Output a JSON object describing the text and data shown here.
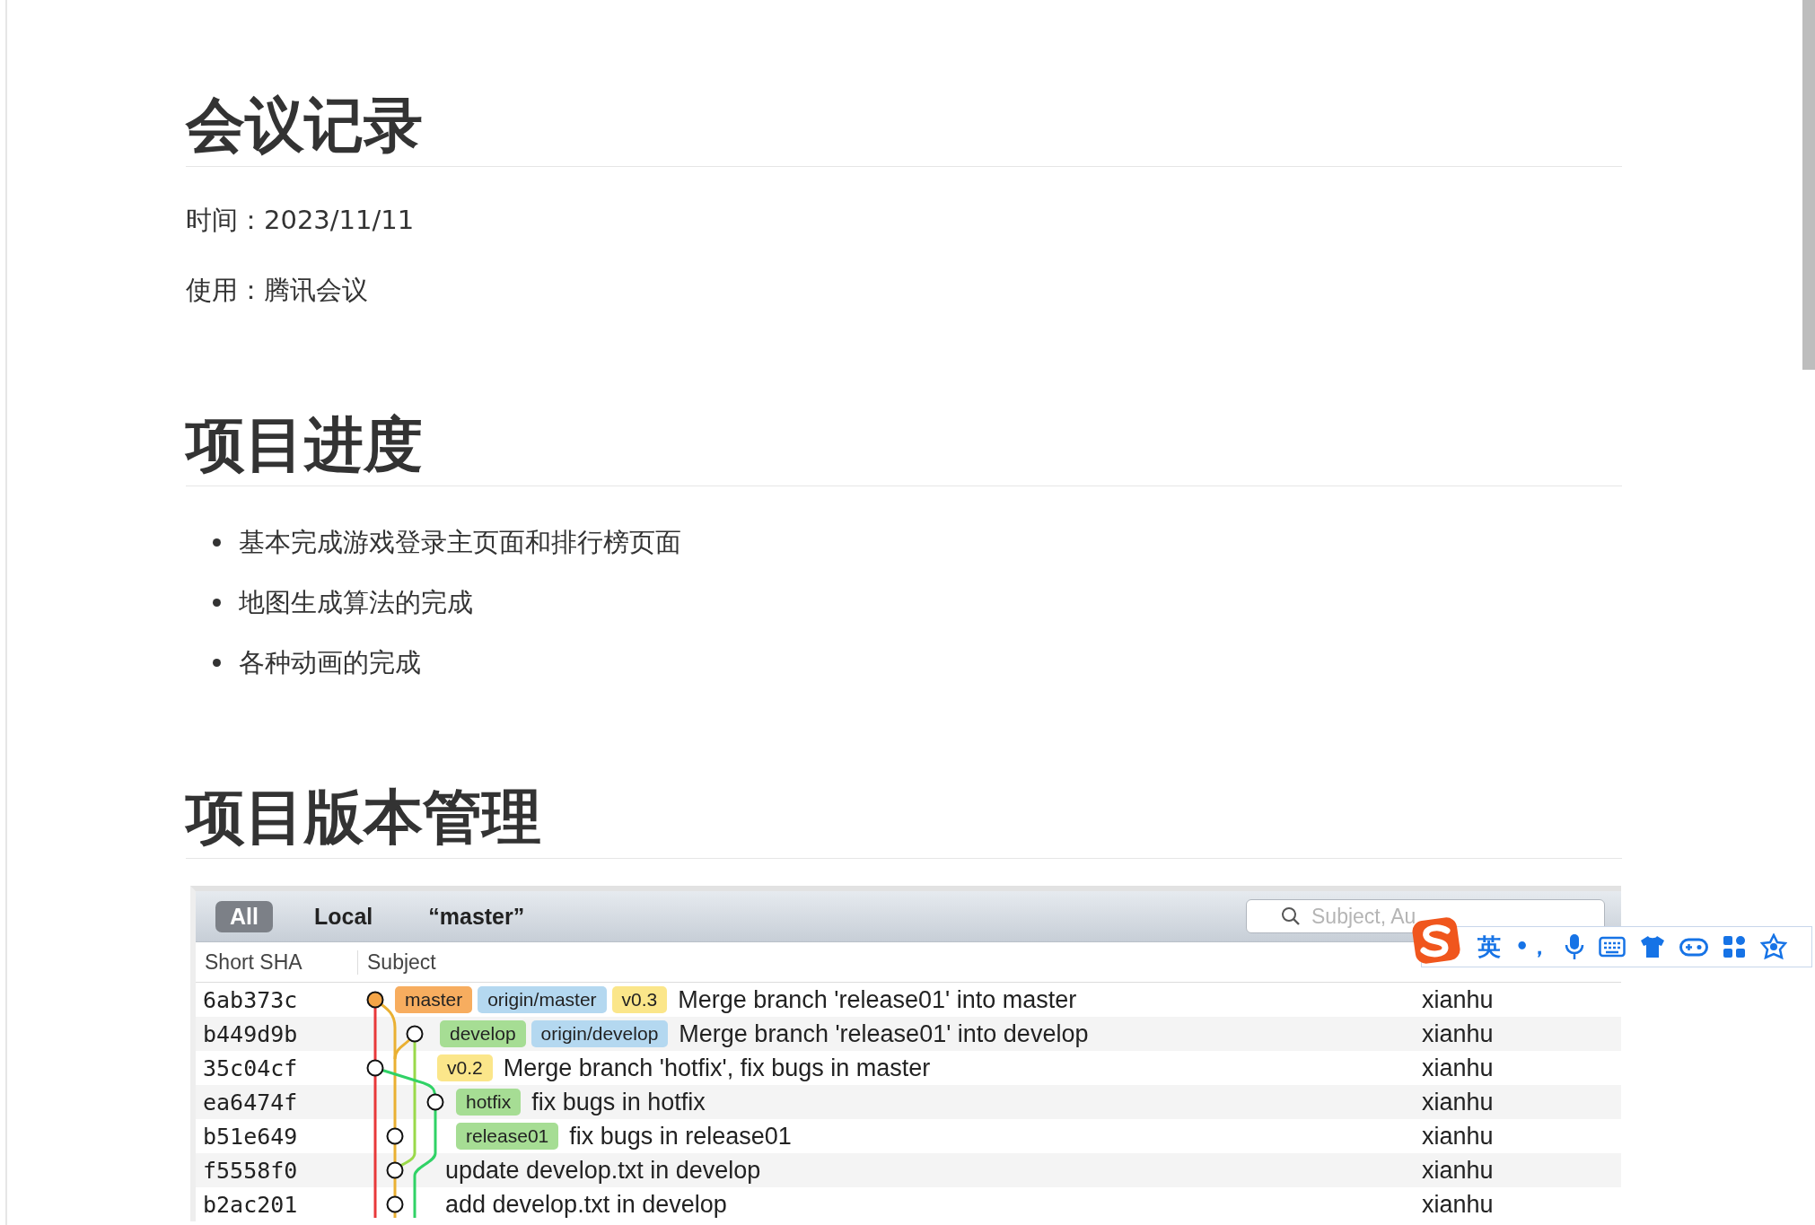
{
  "sections": [
    {
      "heading": "会议记录",
      "paragraphs": [
        "时间：2023/11/11",
        "使用：腾讯会议"
      ]
    },
    {
      "heading": "项目进度",
      "bullets": [
        "基本完成游戏登录主页面和排行榜页面",
        "地图生成算法的完成",
        "各种动画的完成"
      ]
    },
    {
      "heading": "项目版本管理",
      "git_log": {
        "tabs": [
          {
            "label": "All",
            "selected": true
          },
          {
            "label": "Local",
            "selected": false
          },
          {
            "label": "“master”",
            "selected": false
          }
        ],
        "search": {
          "placeholder": "Subject, Au"
        },
        "columns": [
          "Short SHA",
          "Subject"
        ],
        "rows": [
          {
            "sha": "6ab373c",
            "refs": [
              {
                "label": "master",
                "kind": "head"
              },
              {
                "label": "origin/master",
                "kind": "remote"
              },
              {
                "label": "v0.3",
                "kind": "tag"
              }
            ],
            "subject": "Merge branch 'release01' into master",
            "author": "xianhu"
          },
          {
            "sha": "b449d9b",
            "refs": [
              {
                "label": "develop",
                "kind": "branch"
              },
              {
                "label": "origin/develop",
                "kind": "remote"
              }
            ],
            "subject": "Merge branch 'release01' into develop",
            "author": "xianhu"
          },
          {
            "sha": "35c04cf",
            "refs": [
              {
                "label": "v0.2",
                "kind": "tag"
              }
            ],
            "subject": "Merge branch 'hotfix', fix bugs in master",
            "author": "xianhu"
          },
          {
            "sha": "ea6474f",
            "refs": [
              {
                "label": "hotfix",
                "kind": "branch"
              }
            ],
            "subject": "fix bugs in hotfix",
            "author": "xianhu"
          },
          {
            "sha": "b51e649",
            "refs": [
              {
                "label": "release01",
                "kind": "branch"
              }
            ],
            "subject": "fix bugs in release01",
            "author": "xianhu"
          },
          {
            "sha": "f5558f0",
            "refs": [],
            "subject": "update develop.txt in develop",
            "author": "xianhu"
          },
          {
            "sha": "b2ac201",
            "refs": [],
            "subject": "add develop.txt in develop",
            "author": "xianhu"
          }
        ]
      }
    }
  ],
  "ime_toolbar": {
    "mode": "英",
    "punctuation": "•，"
  }
}
